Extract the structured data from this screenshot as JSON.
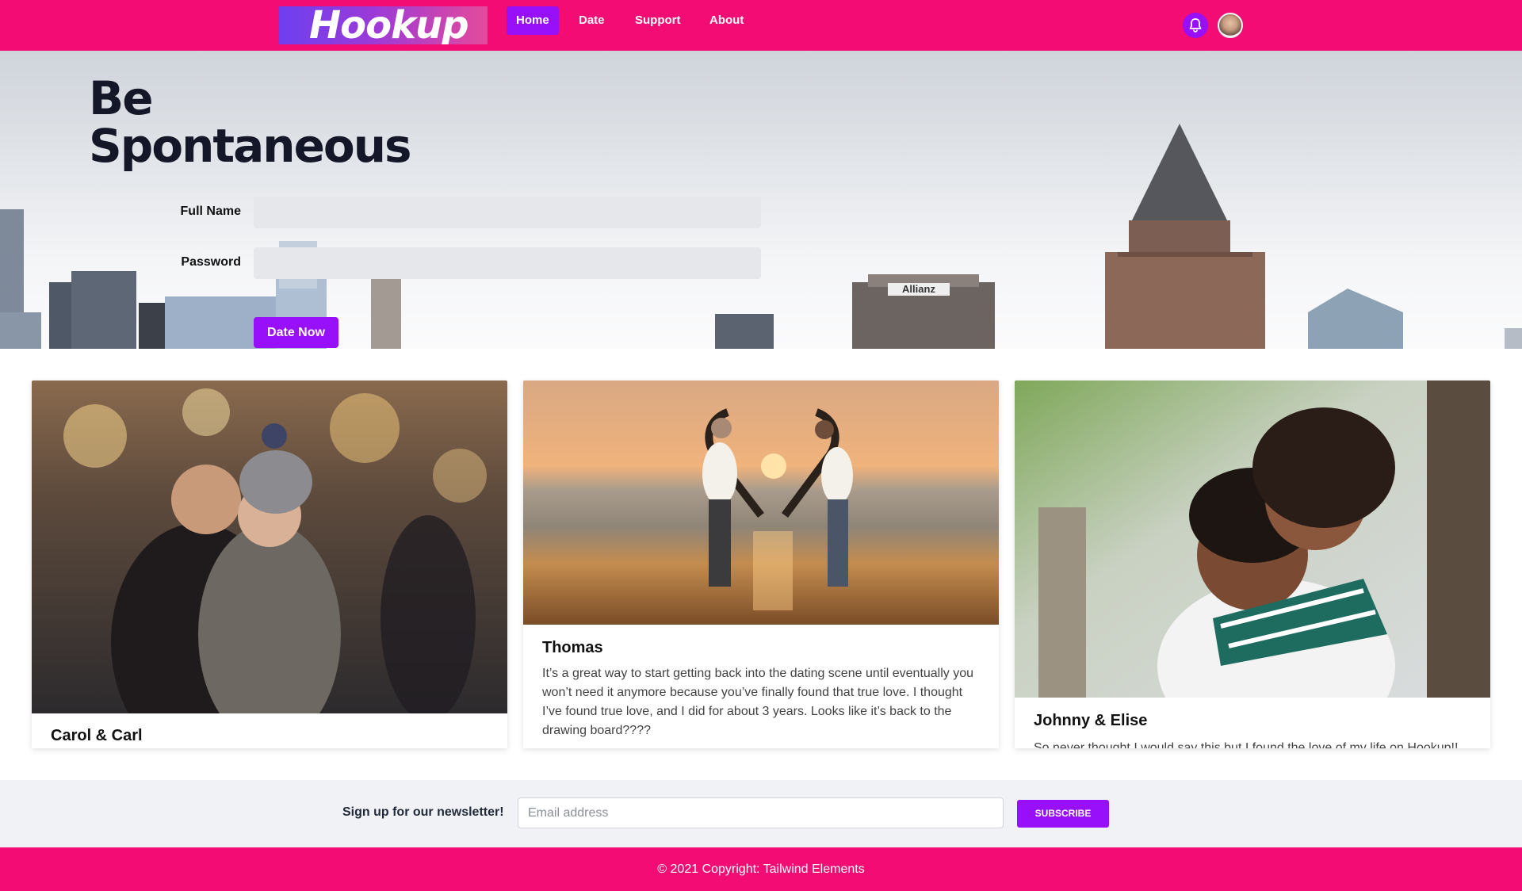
{
  "brand": {
    "logo_text": "Hookup"
  },
  "nav": {
    "items": [
      {
        "label": "Home",
        "active": true
      },
      {
        "label": "Date",
        "active": false
      },
      {
        "label": "Support",
        "active": false
      },
      {
        "label": "About",
        "active": false
      }
    ],
    "icons": [
      "bell-icon",
      "user-avatar"
    ]
  },
  "hero": {
    "title_line1": "Be",
    "title_line2": "Spontaneous",
    "fullname_label": "Full Name",
    "fullname_value": "",
    "password_label": "Password",
    "password_value": "",
    "submit_label": "Date Now",
    "building_sign": "Allianz"
  },
  "cards": [
    {
      "title": "Carol & Carl",
      "text": ""
    },
    {
      "title": "Thomas",
      "text": "It’s a great way to start getting back into the dating scene until eventually you won’t need it anymore because you’ve finally found that true love. I thought I’ve found true love, and I did for about 3 years. Looks like it’s back to the drawing board????"
    },
    {
      "title": "Johnny & Elise",
      "text": "So never thought I would say this but I found the love of my life on Hookup!!"
    }
  ],
  "newsletter": {
    "label": "Sign up for our newsletter!",
    "placeholder": "Email address",
    "button_label": "SUBSCRIBE"
  },
  "footer": {
    "text": "© 2021 Copyright: Tailwind Elements"
  },
  "colors": {
    "brand_pink": "#f20c74",
    "accent_purple": "#9810fa"
  }
}
